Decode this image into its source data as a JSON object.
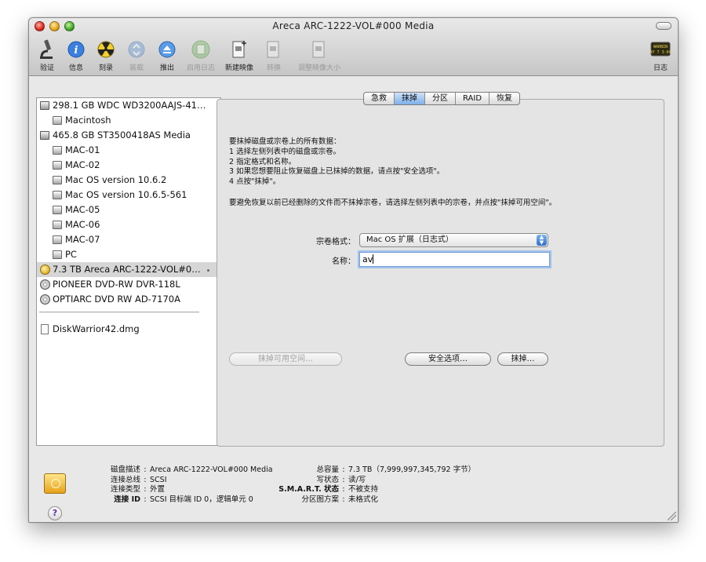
{
  "window": {
    "title": "Areca ARC-1222-VOL#000 Media"
  },
  "toolbar": {
    "items": [
      {
        "label": "验证",
        "icon": "microscope-icon",
        "enabled": true
      },
      {
        "label": "信息",
        "icon": "info-icon",
        "enabled": true
      },
      {
        "label": "刻录",
        "icon": "burn-icon",
        "enabled": true
      },
      {
        "label": "装载",
        "icon": "mount-icon",
        "enabled": false
      },
      {
        "label": "推出",
        "icon": "eject-icon",
        "enabled": true
      },
      {
        "label": "启用日志",
        "icon": "enable-journal-icon",
        "enabled": false
      },
      {
        "label": "新建映像",
        "icon": "new-image-icon",
        "enabled": true
      },
      {
        "label": "转换",
        "icon": "convert-icon",
        "enabled": false
      },
      {
        "label": "调整映像大小",
        "icon": "resize-image-icon",
        "enabled": false
      }
    ],
    "log": {
      "label": "日志",
      "icon": "log-icon",
      "icon_text": "WARNIN\nAY 7 3:04"
    }
  },
  "sidebar": {
    "items": [
      {
        "label": "298.1 GB WDC WD3200AAJS-41…",
        "type": "disk",
        "indent": 0
      },
      {
        "label": "Macintosh",
        "type": "vol",
        "indent": 1
      },
      {
        "label": "465.8 GB ST3500418AS Media",
        "type": "disk",
        "indent": 0
      },
      {
        "label": "MAC-01",
        "type": "vol",
        "indent": 1
      },
      {
        "label": "MAC-02",
        "type": "vol",
        "indent": 1
      },
      {
        "label": "Mac OS version 10.6.2",
        "type": "vol",
        "indent": 1
      },
      {
        "label": "Mac OS version 10.6.5-561",
        "type": "vol",
        "indent": 1
      },
      {
        "label": "MAC-05",
        "type": "vol",
        "indent": 1
      },
      {
        "label": "MAC-06",
        "type": "vol",
        "indent": 1
      },
      {
        "label": "MAC-07",
        "type": "vol",
        "indent": 1
      },
      {
        "label": "PC",
        "type": "vol",
        "indent": 1
      },
      {
        "label": "7.3 TB Areca ARC-1222-VOL#0…",
        "type": "raid",
        "indent": 0,
        "selected": true
      },
      {
        "label": "PIONEER DVD-RW DVR-118L",
        "type": "dvd",
        "indent": 0
      },
      {
        "label": "OPTIARC DVD RW AD-7170A",
        "type": "dvd",
        "indent": 0
      }
    ],
    "images": [
      {
        "label": "DiskWarrior42.dmg",
        "type": "dmg"
      }
    ]
  },
  "tabs": [
    {
      "label": "急救",
      "active": false
    },
    {
      "label": "抹掉",
      "active": true
    },
    {
      "label": "分区",
      "active": false
    },
    {
      "label": "RAID",
      "active": false
    },
    {
      "label": "恢复",
      "active": false
    }
  ],
  "erase": {
    "instructions": [
      "要抹掉磁盘或宗卷上的所有数据：",
      "1 选择左侧列表中的磁盘或宗卷。",
      "2 指定格式和名称。",
      "3 如果您想要阻止恢复磁盘上已抹掉的数据，请点按\"安全选项\"。",
      "4 点按\"抹掉\"。"
    ],
    "note": "要避免恢复以前已经删除的文件而不抹掉宗卷，请选择左侧列表中的宗卷，并点按\"抹掉可用空间\"。",
    "format_label": "宗卷格式：",
    "format_value": "Mac OS 扩展（日志式）",
    "name_label": "名称：",
    "name_value": "av",
    "erase_free_space_button": "抹掉可用空间…",
    "security_options_button": "安全选项…",
    "erase_button": "抹掉…"
  },
  "info": {
    "left": [
      {
        "key": "磁盘描述",
        "value": "Areca ARC-1222-VOL#000 Media",
        "bold": false
      },
      {
        "key": "连接总线",
        "value": "SCSI",
        "bold": false
      },
      {
        "key": "连接类型",
        "value": "外置",
        "bold": false
      },
      {
        "key": "连接 ID",
        "value": "SCSI 目标端 ID 0，逻辑单元 0",
        "bold": true
      }
    ],
    "right": [
      {
        "key": "总容量",
        "value": "7.3 TB（7,999,997,345,792 字节）",
        "bold": false
      },
      {
        "key": "写状态",
        "value": "读/写",
        "bold": false
      },
      {
        "key": "S.M.A.R.T. 状态",
        "value": "不被支持",
        "bold": true
      },
      {
        "key": "分区图方案",
        "value": "未格式化",
        "bold": false
      }
    ],
    "help": "?"
  }
}
